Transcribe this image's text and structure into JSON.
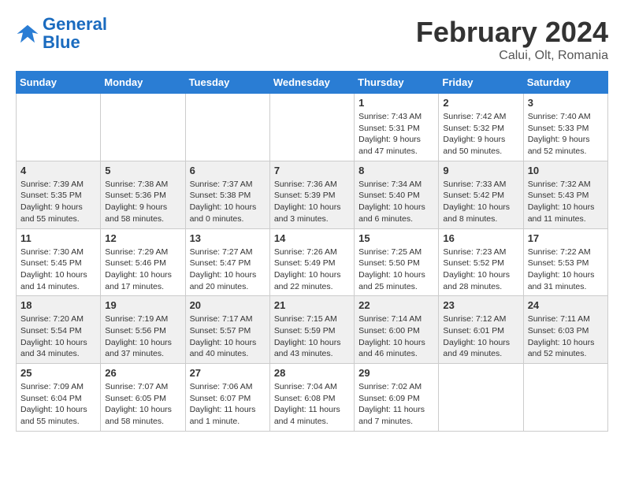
{
  "header": {
    "logo_general": "General",
    "logo_blue": "Blue",
    "month_year": "February 2024",
    "location": "Calui, Olt, Romania"
  },
  "days_of_week": [
    "Sunday",
    "Monday",
    "Tuesday",
    "Wednesday",
    "Thursday",
    "Friday",
    "Saturday"
  ],
  "weeks": [
    [
      {
        "day": "",
        "info": ""
      },
      {
        "day": "",
        "info": ""
      },
      {
        "day": "",
        "info": ""
      },
      {
        "day": "",
        "info": ""
      },
      {
        "day": "1",
        "info": "Sunrise: 7:43 AM\nSunset: 5:31 PM\nDaylight: 9 hours and 47 minutes."
      },
      {
        "day": "2",
        "info": "Sunrise: 7:42 AM\nSunset: 5:32 PM\nDaylight: 9 hours and 50 minutes."
      },
      {
        "day": "3",
        "info": "Sunrise: 7:40 AM\nSunset: 5:33 PM\nDaylight: 9 hours and 52 minutes."
      }
    ],
    [
      {
        "day": "4",
        "info": "Sunrise: 7:39 AM\nSunset: 5:35 PM\nDaylight: 9 hours and 55 minutes."
      },
      {
        "day": "5",
        "info": "Sunrise: 7:38 AM\nSunset: 5:36 PM\nDaylight: 9 hours and 58 minutes."
      },
      {
        "day": "6",
        "info": "Sunrise: 7:37 AM\nSunset: 5:38 PM\nDaylight: 10 hours and 0 minutes."
      },
      {
        "day": "7",
        "info": "Sunrise: 7:36 AM\nSunset: 5:39 PM\nDaylight: 10 hours and 3 minutes."
      },
      {
        "day": "8",
        "info": "Sunrise: 7:34 AM\nSunset: 5:40 PM\nDaylight: 10 hours and 6 minutes."
      },
      {
        "day": "9",
        "info": "Sunrise: 7:33 AM\nSunset: 5:42 PM\nDaylight: 10 hours and 8 minutes."
      },
      {
        "day": "10",
        "info": "Sunrise: 7:32 AM\nSunset: 5:43 PM\nDaylight: 10 hours and 11 minutes."
      }
    ],
    [
      {
        "day": "11",
        "info": "Sunrise: 7:30 AM\nSunset: 5:45 PM\nDaylight: 10 hours and 14 minutes."
      },
      {
        "day": "12",
        "info": "Sunrise: 7:29 AM\nSunset: 5:46 PM\nDaylight: 10 hours and 17 minutes."
      },
      {
        "day": "13",
        "info": "Sunrise: 7:27 AM\nSunset: 5:47 PM\nDaylight: 10 hours and 20 minutes."
      },
      {
        "day": "14",
        "info": "Sunrise: 7:26 AM\nSunset: 5:49 PM\nDaylight: 10 hours and 22 minutes."
      },
      {
        "day": "15",
        "info": "Sunrise: 7:25 AM\nSunset: 5:50 PM\nDaylight: 10 hours and 25 minutes."
      },
      {
        "day": "16",
        "info": "Sunrise: 7:23 AM\nSunset: 5:52 PM\nDaylight: 10 hours and 28 minutes."
      },
      {
        "day": "17",
        "info": "Sunrise: 7:22 AM\nSunset: 5:53 PM\nDaylight: 10 hours and 31 minutes."
      }
    ],
    [
      {
        "day": "18",
        "info": "Sunrise: 7:20 AM\nSunset: 5:54 PM\nDaylight: 10 hours and 34 minutes."
      },
      {
        "day": "19",
        "info": "Sunrise: 7:19 AM\nSunset: 5:56 PM\nDaylight: 10 hours and 37 minutes."
      },
      {
        "day": "20",
        "info": "Sunrise: 7:17 AM\nSunset: 5:57 PM\nDaylight: 10 hours and 40 minutes."
      },
      {
        "day": "21",
        "info": "Sunrise: 7:15 AM\nSunset: 5:59 PM\nDaylight: 10 hours and 43 minutes."
      },
      {
        "day": "22",
        "info": "Sunrise: 7:14 AM\nSunset: 6:00 PM\nDaylight: 10 hours and 46 minutes."
      },
      {
        "day": "23",
        "info": "Sunrise: 7:12 AM\nSunset: 6:01 PM\nDaylight: 10 hours and 49 minutes."
      },
      {
        "day": "24",
        "info": "Sunrise: 7:11 AM\nSunset: 6:03 PM\nDaylight: 10 hours and 52 minutes."
      }
    ],
    [
      {
        "day": "25",
        "info": "Sunrise: 7:09 AM\nSunset: 6:04 PM\nDaylight: 10 hours and 55 minutes."
      },
      {
        "day": "26",
        "info": "Sunrise: 7:07 AM\nSunset: 6:05 PM\nDaylight: 10 hours and 58 minutes."
      },
      {
        "day": "27",
        "info": "Sunrise: 7:06 AM\nSunset: 6:07 PM\nDaylight: 11 hours and 1 minute."
      },
      {
        "day": "28",
        "info": "Sunrise: 7:04 AM\nSunset: 6:08 PM\nDaylight: 11 hours and 4 minutes."
      },
      {
        "day": "29",
        "info": "Sunrise: 7:02 AM\nSunset: 6:09 PM\nDaylight: 11 hours and 7 minutes."
      },
      {
        "day": "",
        "info": ""
      },
      {
        "day": "",
        "info": ""
      }
    ]
  ]
}
